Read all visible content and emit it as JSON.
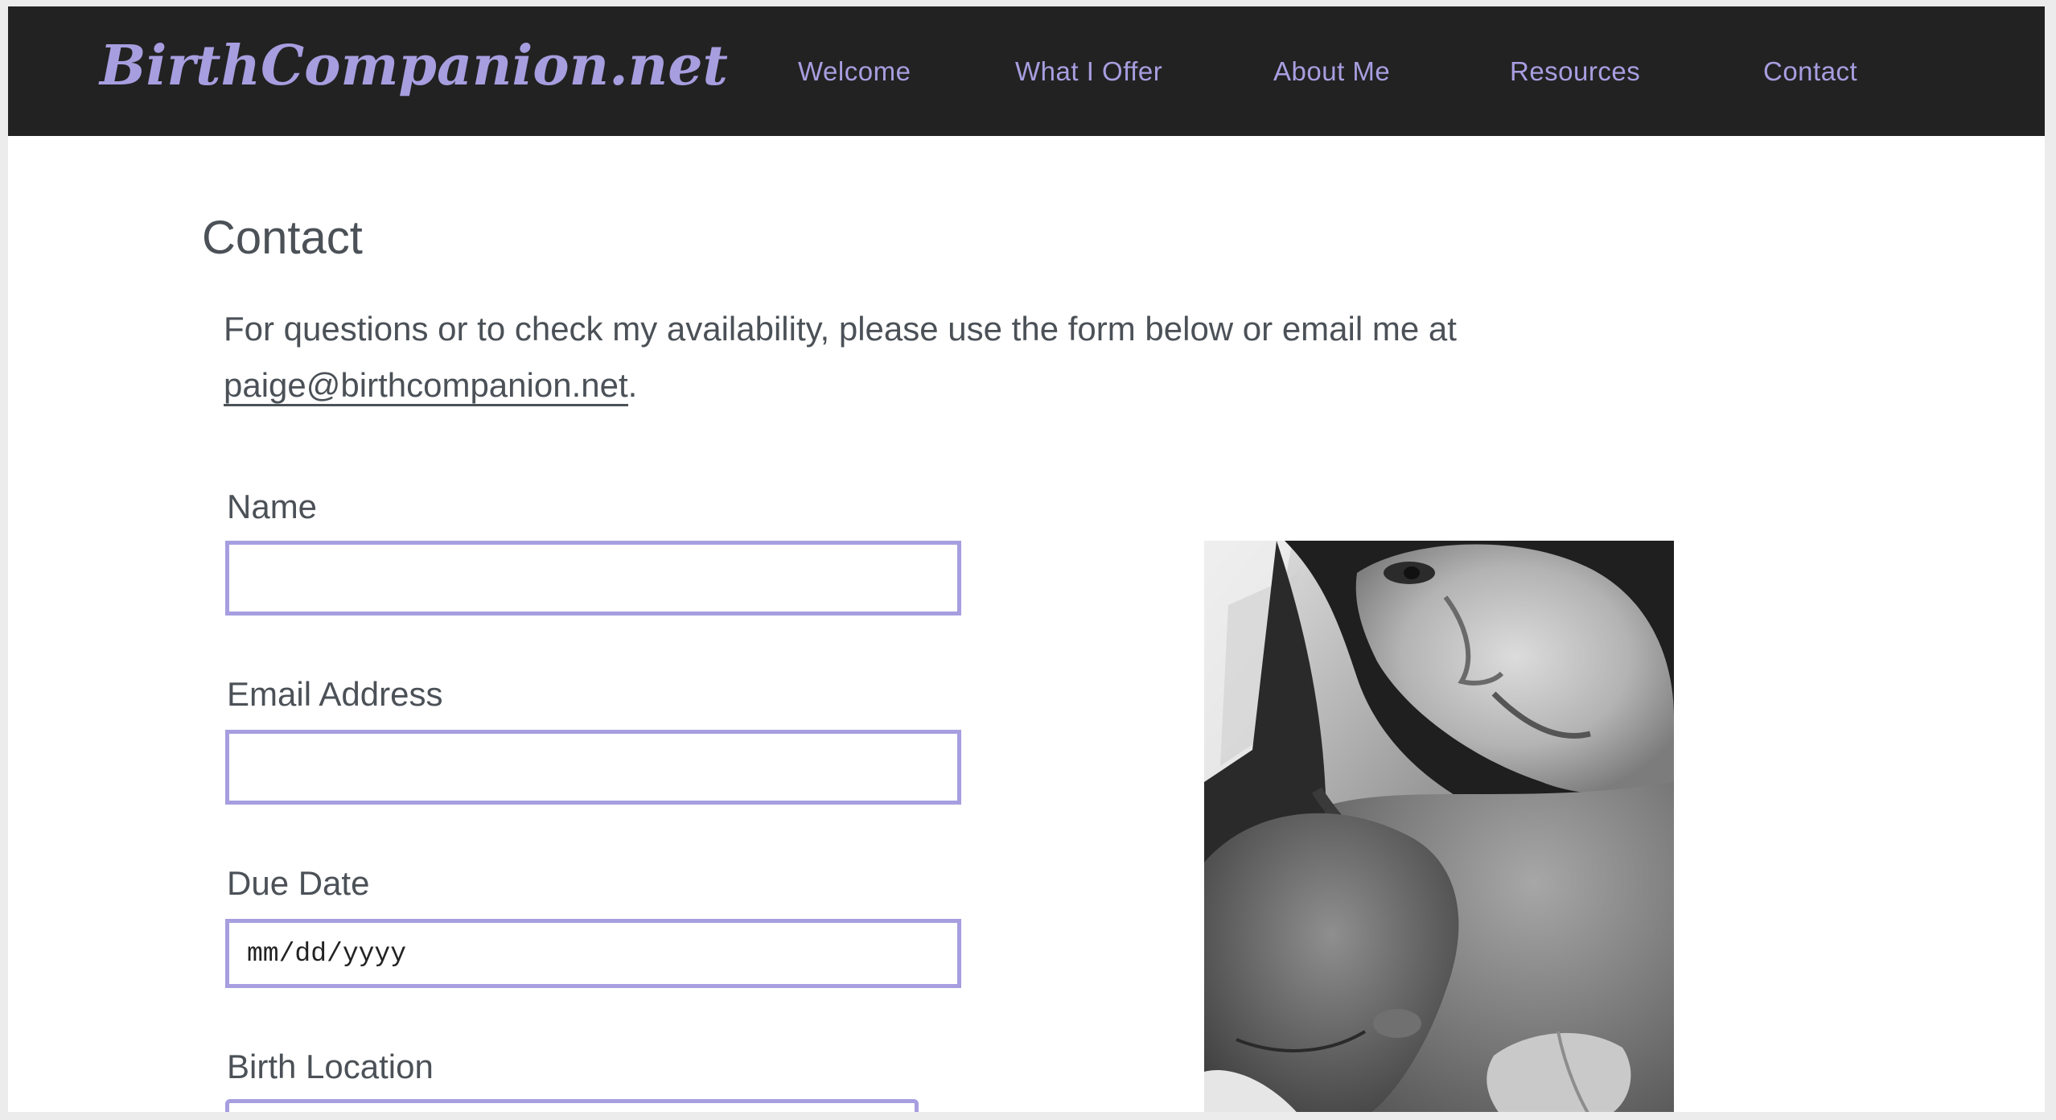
{
  "header": {
    "brand": "BirthCompanion.net",
    "nav": [
      {
        "label": "Welcome"
      },
      {
        "label": "What I Offer"
      },
      {
        "label": "About Me"
      },
      {
        "label": "Resources"
      },
      {
        "label": "Contact"
      }
    ]
  },
  "main": {
    "title": "Contact",
    "intro_text": "For questions or to check my availability, please use the form below or email me at ",
    "email_link": "paige@birthcompanion.net",
    "intro_end": "."
  },
  "form": {
    "name": {
      "label": "Name",
      "value": "",
      "placeholder": ""
    },
    "email": {
      "label": "Email Address",
      "value": "",
      "placeholder": ""
    },
    "due_date": {
      "label": "Due Date",
      "value": "",
      "placeholder": "mm/dd/yyyy"
    },
    "birth_location": {
      "label": "Birth Location",
      "value": "",
      "placeholder": ""
    }
  },
  "photo": {
    "description_icon": "photo-mother-newborn",
    "style": "black-and-white"
  },
  "colors": {
    "header_bg": "#222222",
    "accent": "#a79ee0",
    "text": "#4b5157",
    "page_bg": "#ffffff"
  }
}
